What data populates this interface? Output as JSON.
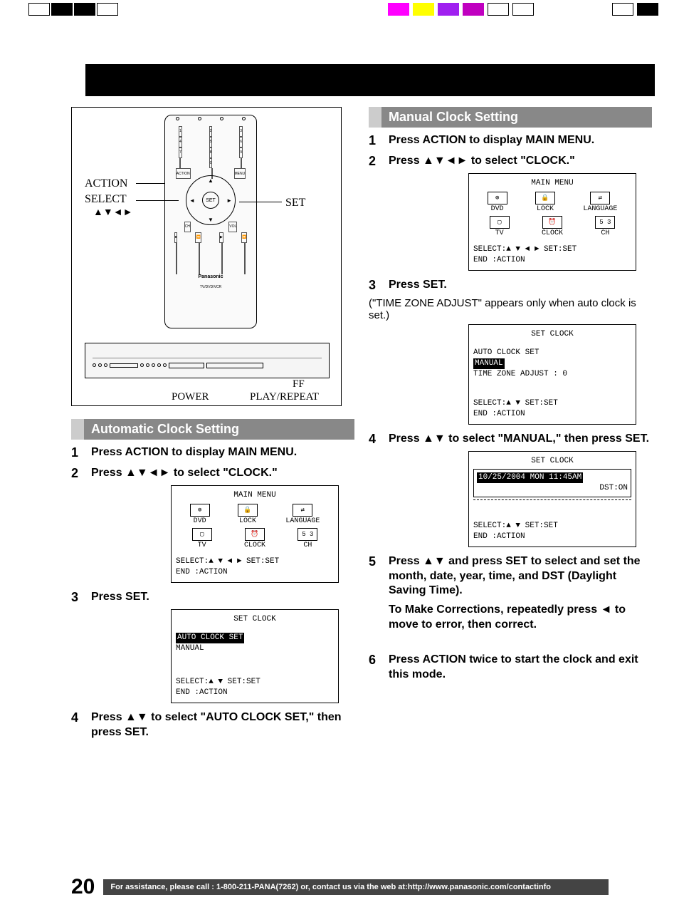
{
  "remote": {
    "label_action": "ACTION",
    "label_select": "SELECT",
    "label_select_arrows": "▲▼◄►",
    "label_set": "SET",
    "label_ff": "FF",
    "label_power": "POWER",
    "label_play": "PLAY/REPEAT"
  },
  "sections": {
    "auto": {
      "title": "Automatic Clock Setting",
      "steps": {
        "s1": "Press ACTION to display MAIN MENU.",
        "s2": "Press ▲▼◄► to select \"CLOCK.\"",
        "s3": "Press SET.",
        "s4": "Press ▲▼ to select \"AUTO CLOCK SET,\" then press SET."
      }
    },
    "manual": {
      "title": "Manual Clock Setting",
      "steps": {
        "s1": "Press ACTION to display MAIN MENU.",
        "s2": "Press ▲▼◄► to select \"CLOCK.\"",
        "s3": "Press SET.",
        "s3_note": "(\"TIME ZONE ADJUST\" appears only when auto clock is set.)",
        "s4": "Press ▲▼ to select \"MANUAL,\" then press SET.",
        "s5": "Press ▲▼ and press SET to select and set the month, date, year, time, and DST (Daylight Saving Time).",
        "s5_sub": "To Make Corrections, repeatedly press ◄ to move to error, then correct.",
        "s6": "Press ACTION twice to start the clock and exit this mode."
      }
    }
  },
  "osd": {
    "main_menu": {
      "title": "MAIN MENU",
      "items": {
        "dvd": "DVD",
        "lock": "LOCK",
        "lang": "LANGUAGE",
        "tv": "TV",
        "clock": "CLOCK",
        "ch": "CH",
        "ch_badge": "5 3"
      },
      "foot1": "SELECT:▲ ▼ ◄ ►   SET:SET",
      "foot2": "END   :ACTION"
    },
    "set_clock_auto": {
      "title": "SET CLOCK",
      "line1": "AUTO CLOCK SET",
      "line2": "MANUAL",
      "foot1": "SELECT:▲ ▼       SET:SET",
      "foot2": "END   :ACTION"
    },
    "set_clock_manual1": {
      "title": "SET CLOCK",
      "line1": "AUTO CLOCK SET",
      "line2": "MANUAL",
      "line3": "TIME ZONE ADJUST : 0",
      "foot1": "SELECT:▲ ▼       SET:SET",
      "foot2": "END   :ACTION"
    },
    "set_clock_manual2": {
      "title": "SET CLOCK",
      "date": "10/25/2004 MON 11:45AM",
      "dst": "DST:ON",
      "foot1": "SELECT:▲ ▼       SET:SET",
      "foot2": "END   :ACTION"
    }
  },
  "footer": {
    "page": "20",
    "text": "For assistance, please call : 1-800-211-PANA(7262) or, contact us via the web at:http://www.panasonic.com/contactinfo"
  }
}
